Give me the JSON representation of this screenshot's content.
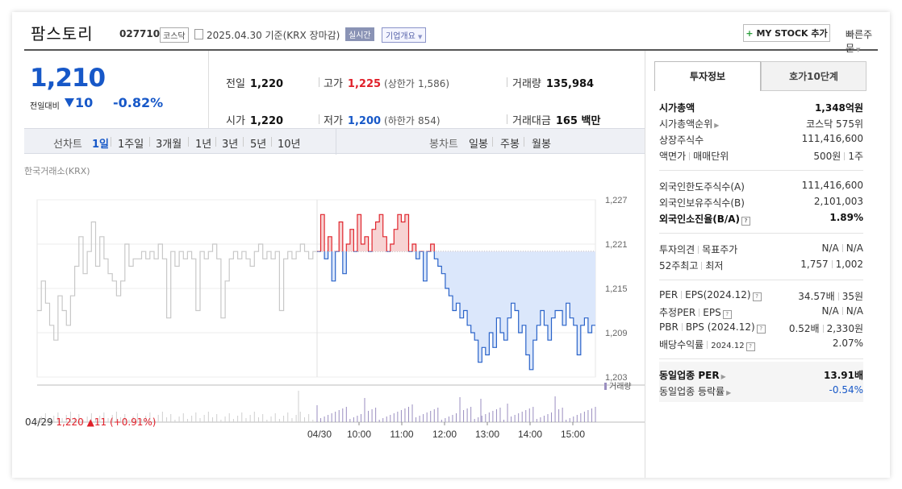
{
  "header": {
    "company_name": "팜스토리",
    "code": "027710",
    "market": "코스닥",
    "date_text": "2025.04.30 기준(KRX 장마감)",
    "realtime_badge": "실시간",
    "company_info_label": "기업개요",
    "my_stock_plus": "+",
    "my_stock_label": "MY STOCK 추가",
    "quick_order_label": "빠른주문"
  },
  "price": {
    "current": "1,210",
    "compare_label": "전일대비",
    "change": "10",
    "change_pct": "-0.82%"
  },
  "stats": {
    "prev_label": "전일",
    "prev": "1,220",
    "high_label": "고가",
    "high": "1,225",
    "upper_limit_label": "(상한가",
    "upper_limit": "1,586)",
    "volume_label": "거래량",
    "volume": "135,984",
    "open_label": "시가",
    "open": "1,220",
    "low_label": "저가",
    "low": "1,200",
    "lower_limit_label": "(하한가",
    "lower_limit": "854)",
    "amount_label": "거래대금",
    "amount": "165 백만"
  },
  "periods": {
    "line_label": "선차트",
    "line_items": [
      "1일",
      "1주일",
      "3개월",
      "1년",
      "3년",
      "5년",
      "10년"
    ],
    "candle_label": "봉차트",
    "candle_items": [
      "일봉",
      "주봉",
      "월봉"
    ]
  },
  "chart_labels": {
    "exchange": "한국거래소(KRX)",
    "volume_legend": "거래량",
    "prev_day_label": "04/29",
    "prev_day_close": "1,220",
    "prev_day_change": "11",
    "prev_day_pct": "(+0.91%)",
    "day_label": "04/30"
  },
  "chart_data": {
    "type": "line",
    "y_ticks": [
      "1,227",
      "1,221",
      "1,215",
      "1,209",
      "1,203"
    ],
    "ylim": [
      1203,
      1227
    ],
    "x_ticks": [
      "04/30",
      "10:00",
      "11:00",
      "12:00",
      "13:00",
      "14:00",
      "15:00"
    ],
    "reference_price": 1220,
    "series": [
      {
        "name": "",
        "note": "04/29 previous day",
        "color": "#c8c8c8",
        "values": [
          1212,
          1216,
          1213,
          1210,
          1208,
          1214,
          1212,
          1210,
          1214,
          1218,
          1222,
          1217,
          1220,
          1224,
          1218,
          1222,
          1219,
          1217,
          1216,
          1214,
          1216,
          1221,
          1218,
          1219,
          1219,
          1220,
          1219,
          1220,
          1219,
          1221,
          1219,
          1211,
          1220,
          1218,
          1220,
          1219,
          1220,
          1219,
          1212,
          1220,
          1219,
          1220,
          1221,
          1219,
          1211,
          1216,
          1219,
          1220,
          1219,
          1220,
          1219,
          1218,
          1220,
          1221,
          1219,
          1220,
          1219,
          1220,
          1212,
          1219,
          1220,
          1219,
          1220,
          1221,
          1220,
          1219,
          1220,
          1220
        ]
      },
      {
        "name": "",
        "note": "04/30 current day",
        "color": "#2a63c9",
        "values": [
          1220,
          1225,
          1219,
          1222,
          1216,
          1220,
          1224,
          1217,
          1221,
          1223,
          1220,
          1225,
          1221,
          1222,
          1220,
          1223,
          1224,
          1225,
          1222,
          1220,
          1221,
          1223,
          1225,
          1224,
          1225,
          1220,
          1221,
          1219,
          1220,
          1216,
          1220,
          1221,
          1219,
          1218,
          1217,
          1215,
          1214,
          1212,
          1213,
          1211,
          1212,
          1210,
          1209,
          1208,
          1205,
          1207,
          1206,
          1209,
          1207,
          1211,
          1209,
          1208,
          1211,
          1213,
          1212,
          1209,
          1210,
          1206,
          1204,
          1208,
          1210,
          1212,
          1210,
          1208,
          1211,
          1212,
          1212,
          1210,
          1213,
          1211,
          1210,
          1206,
          1210,
          1211,
          1209,
          1210,
          1210
        ]
      }
    ]
  },
  "right_panel": {
    "tab_active": "투자정보",
    "tab_other": "호가10단계",
    "market_cap_label": "시가총액",
    "market_cap": "1,348억원",
    "cap_rank_label": "시가총액순위",
    "cap_rank": "코스닥 575위",
    "shares_label": "상장주식수",
    "shares": "111,416,600",
    "par_label": "액면가",
    "unit_label": "매매단위",
    "par": "500원",
    "unit": "1주",
    "foreign_limit_label": "외국인한도주식수(A)",
    "foreign_limit": "111,416,600",
    "foreign_hold_label": "외국인보유주식수(B)",
    "foreign_hold": "2,101,003",
    "foreign_ratio_label": "외국인소진율(B/A)",
    "foreign_ratio": "1.89%",
    "opinion_label": "투자의견",
    "target_label": "목표주가",
    "opinion": "N/A",
    "target": "N/A",
    "high52_label": "52주최고",
    "low52_label": "최저",
    "high52": "1,757",
    "low52": "1,002",
    "per_label": "PER",
    "eps_label": "EPS(2024.12)",
    "per": "34.57배",
    "eps": "35원",
    "est_per_label": "추정PER",
    "est_eps_label": "EPS",
    "est_per": "N/A",
    "est_eps": "N/A",
    "pbr_label": "PBR",
    "bps_label": "BPS (2024.12)",
    "pbr": "0.52배",
    "bps": "2,330원",
    "div_label": "배당수익률",
    "div_date": "2024.12",
    "div": "2.07%",
    "sector_per_label": "동일업종 PER",
    "sector_per": "13.91배",
    "sector_change_label": "동일업종 등락률",
    "sector_change": "-0.54%"
  }
}
